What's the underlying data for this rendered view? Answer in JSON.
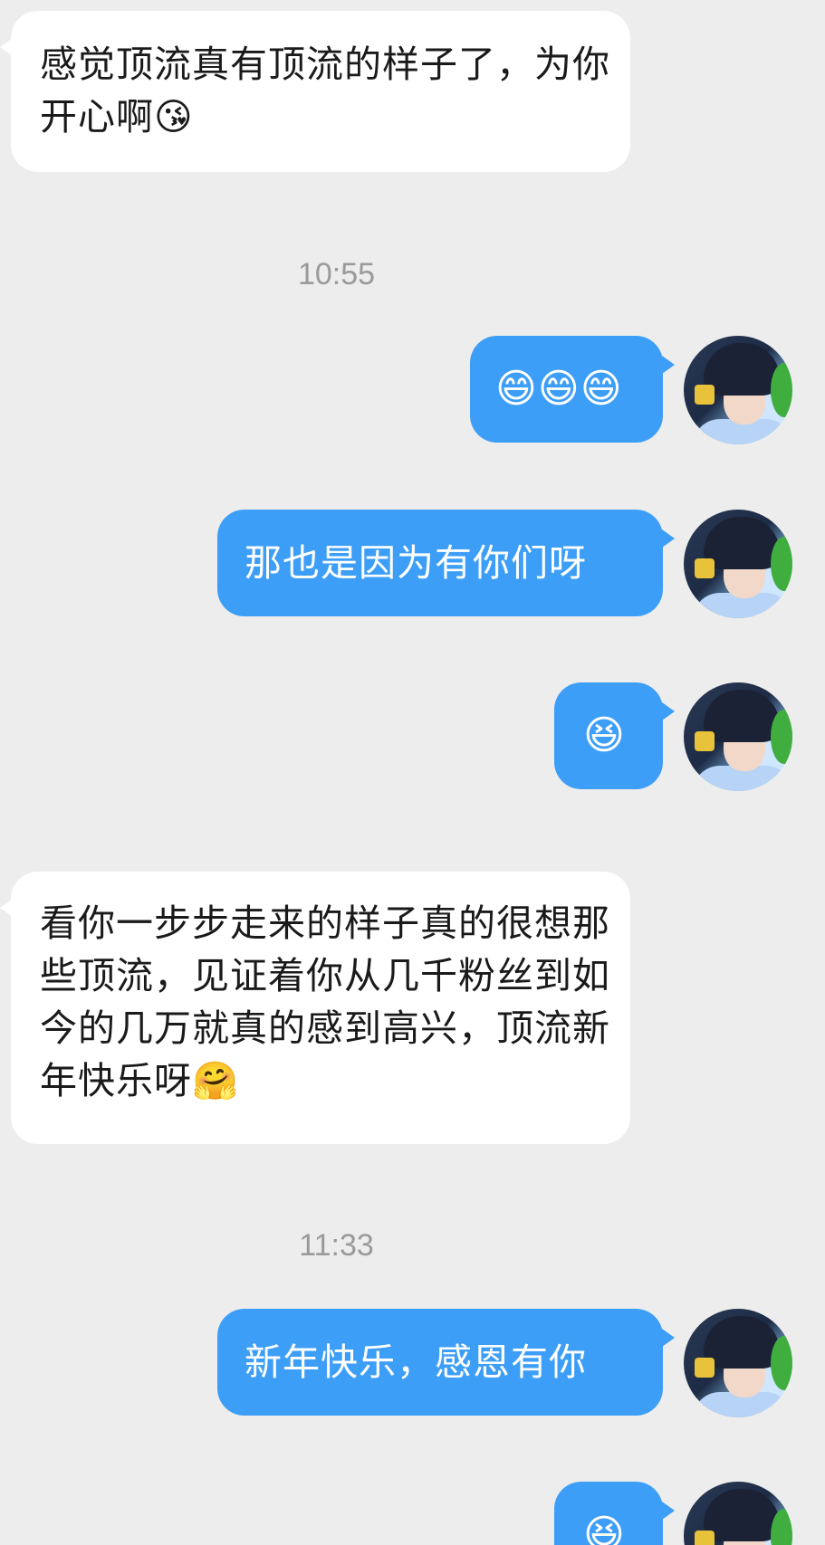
{
  "messages": [
    {
      "side": "in",
      "text": "感觉顶流真有顶流的样子了，为你开心啊😘"
    },
    {
      "side": "out",
      "text": "😄😄😄"
    },
    {
      "side": "out",
      "text": "那也是因为有你们呀"
    },
    {
      "side": "out",
      "text": "😆"
    },
    {
      "side": "in",
      "text": "看你一步步走来的样子真的很想那些顶流，见证着你从几千粉丝到如今的几万就真的感到高兴，顶流新年快乐呀🤗"
    },
    {
      "side": "out",
      "text": "新年快乐，感恩有你"
    },
    {
      "side": "out",
      "text": "😆"
    }
  ],
  "timestamps": [
    "10:55",
    "11:33"
  ],
  "colors": {
    "background": "#ededed",
    "incoming_bubble": "#ffffff",
    "outgoing_bubble": "#3d9ef7",
    "timestamp_text": "#9a9a9a"
  }
}
